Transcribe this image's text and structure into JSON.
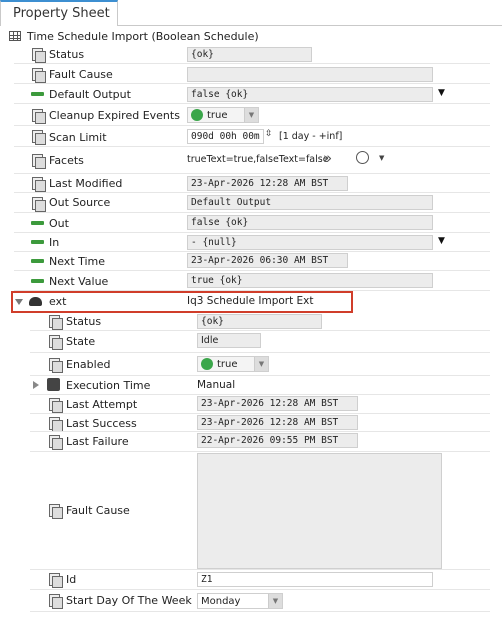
{
  "tab": {
    "label": "Property Sheet"
  },
  "header": {
    "title": "Time Schedule Import  (Boolean Schedule)"
  },
  "props": {
    "status": {
      "label": "Status",
      "value": "{ok}"
    },
    "fault_cause": {
      "label": "Fault Cause",
      "value": ""
    },
    "default_output": {
      "label": "Default Output",
      "value": "false {ok}"
    },
    "cleanup": {
      "label": "Cleanup Expired Events",
      "value": "true"
    },
    "scan_limit": {
      "label": "Scan Limit",
      "value": "090d 00h 00m",
      "range": "[1 day - +inf]"
    },
    "facets": {
      "label": "Facets",
      "value": "trueText=true,falseText=false"
    },
    "last_modified": {
      "label": "Last Modified",
      "value": "23-Apr-2026 12:28 AM BST"
    },
    "out_source": {
      "label": "Out Source",
      "value": "Default Output"
    },
    "out": {
      "label": "Out",
      "value": "false {ok}"
    },
    "in": {
      "label": "In",
      "value": "- {null}"
    },
    "next_time": {
      "label": "Next Time",
      "value": "23-Apr-2026 06:30 AM BST"
    },
    "next_value": {
      "label": "Next Value",
      "value": "true {ok}"
    }
  },
  "ext": {
    "label": "ext",
    "value": "Iq3 Schedule Import Ext",
    "status": {
      "label": "Status",
      "value": "{ok}"
    },
    "state": {
      "label": "State",
      "value": "Idle"
    },
    "enabled": {
      "label": "Enabled",
      "value": "true"
    },
    "execution_time": {
      "label": "Execution Time",
      "value": "Manual"
    },
    "last_attempt": {
      "label": "Last Attempt",
      "value": "23-Apr-2026 12:28 AM BST"
    },
    "last_success": {
      "label": "Last Success",
      "value": "23-Apr-2026 12:28 AM BST"
    },
    "last_failure": {
      "label": "Last Failure",
      "value": "22-Apr-2026 09:55 PM BST"
    },
    "fault_cause": {
      "label": "Fault Cause",
      "value": ""
    },
    "id": {
      "label": "Id",
      "value": "Z1"
    },
    "start_day": {
      "label": "Start Day Of The Week",
      "value": "Monday"
    }
  },
  "colors": {
    "accent": "#3d8fd1",
    "highlight": "#d03d2a",
    "ok_green": "#3aa64a"
  }
}
